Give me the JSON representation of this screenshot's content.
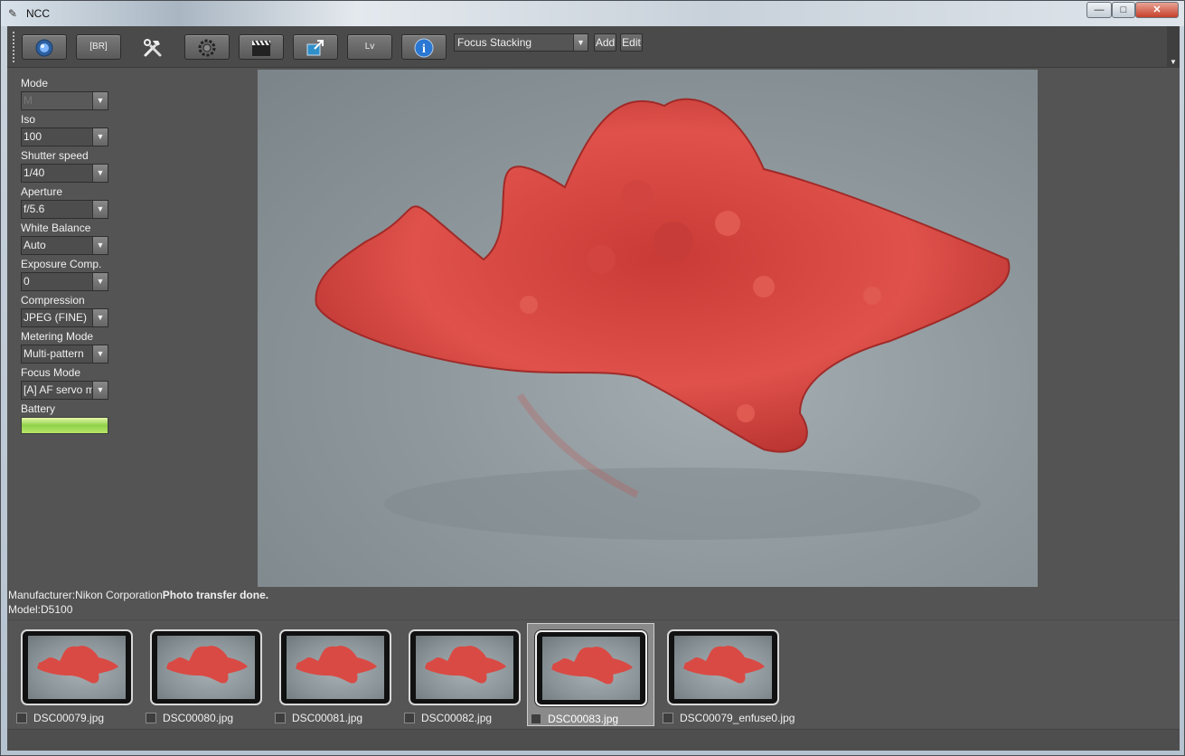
{
  "window": {
    "title": "NCC",
    "minimize_label": "—",
    "maximize_label": "□",
    "close_label": "✕"
  },
  "toolbar": {
    "br_label": "[BR]",
    "lv_label": "Lv",
    "preset": "Focus Stacking",
    "add_label": "Add",
    "edit_label": "Edit",
    "icons": [
      "capture-icon",
      "bracketing-button",
      "tools-icon",
      "settings-gear-icon",
      "movie-clapper-icon",
      "external-window-icon",
      "live-view-button",
      "info-icon"
    ]
  },
  "settings": [
    {
      "label": "Mode",
      "value": "M",
      "disabled": true
    },
    {
      "label": "Iso",
      "value": "100"
    },
    {
      "label": "Shutter speed",
      "value": "1/40"
    },
    {
      "label": "Aperture",
      "value": "f/5.6"
    },
    {
      "label": "White Balance",
      "value": "Auto"
    },
    {
      "label": "Exposure Comp.",
      "value": "0"
    },
    {
      "label": "Compression",
      "value": "JPEG (FINE)"
    },
    {
      "label": "Metering Mode",
      "value": "Multi-pattern"
    },
    {
      "label": "Focus Mode",
      "value": "[A] AF servo m"
    }
  ],
  "battery": {
    "label": "Battery",
    "level": 1.0
  },
  "status": {
    "manufacturer": "Manufacturer:Nikon Corporation",
    "message": "Photo transfer done.",
    "model": "Model:D5100"
  },
  "thumbnails": [
    {
      "name": "DSC00079.jpg",
      "selected": false
    },
    {
      "name": "DSC00080.jpg",
      "selected": false
    },
    {
      "name": "DSC00081.jpg",
      "selected": false
    },
    {
      "name": "DSC00082.jpg",
      "selected": false
    },
    {
      "name": "DSC00083.jpg",
      "selected": true
    },
    {
      "name": "DSC00079_enfuse0.jpg",
      "selected": false
    }
  ],
  "colors": {
    "panel": "#545454",
    "starfish": "#d6453f",
    "battery": "#8fd14a"
  }
}
